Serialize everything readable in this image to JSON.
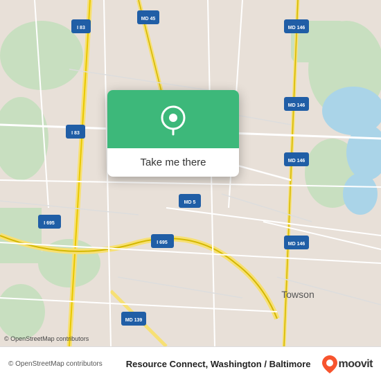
{
  "map": {
    "attribution": "© OpenStreetMap contributors",
    "popup": {
      "button_label": "Take me there"
    },
    "accent_color": "#3db87a"
  },
  "bottom_bar": {
    "title": "Resource Connect, Washington / Baltimore",
    "moovit_brand": "moovit"
  }
}
